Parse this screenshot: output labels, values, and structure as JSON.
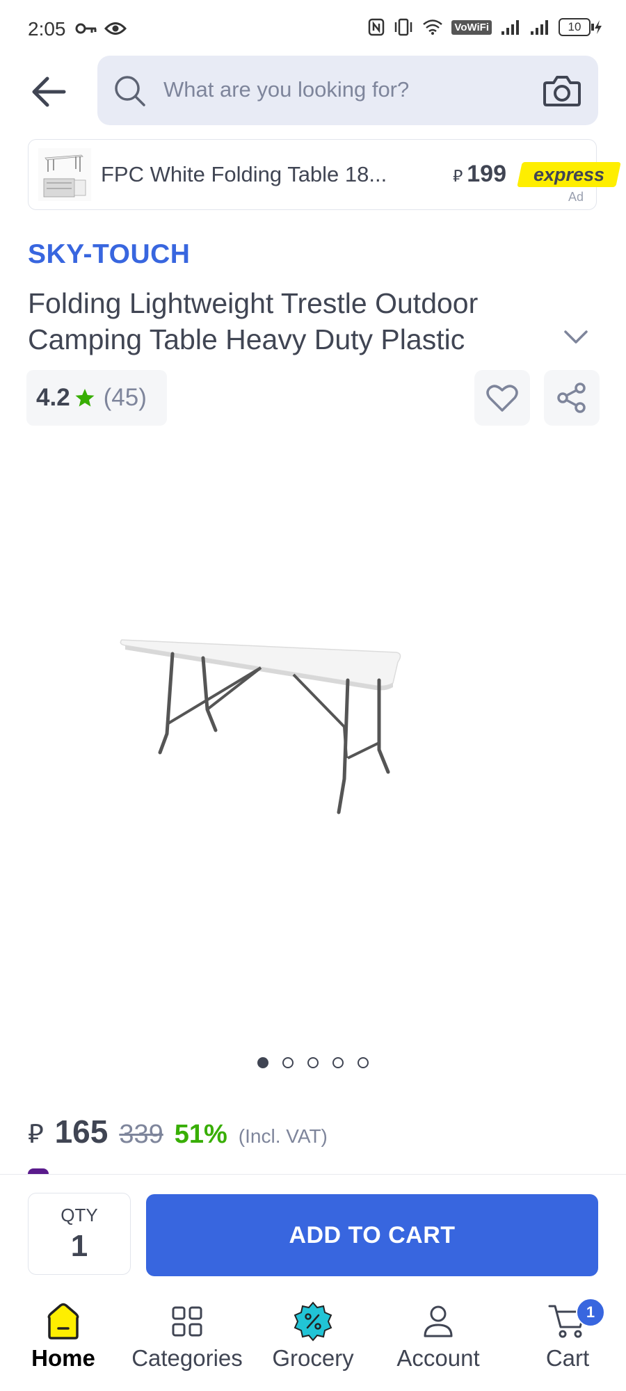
{
  "status_bar": {
    "time": "2:05",
    "vowifi_label": "VoWiFi",
    "battery_level": "10"
  },
  "search": {
    "placeholder": "What are you looking for?"
  },
  "ad": {
    "title": "FPC White Folding Table 18...",
    "currency": "⃁",
    "price": "199",
    "badge": "express",
    "label": "Ad"
  },
  "product": {
    "brand": "SKY-TOUCH",
    "title": "Folding Lightweight Trestle Outdoor Camping Table Heavy Duty Plastic",
    "rating": "4.2",
    "rating_count": "(45)",
    "image_count": 5,
    "active_image": 1,
    "currency": "⃁",
    "price": "165",
    "old_price": "339",
    "discount": "51%",
    "vat_note": "(Incl. VAT)"
  },
  "cart_bar": {
    "qty_label": "QTY",
    "qty_value": "1",
    "add_to_cart": "ADD TO CART"
  },
  "bottom_nav": {
    "items": [
      {
        "label": "Home",
        "icon": "home-icon",
        "active": true
      },
      {
        "label": "Categories",
        "icon": "categories-icon",
        "active": false
      },
      {
        "label": "Grocery",
        "icon": "grocery-icon",
        "active": false
      },
      {
        "label": "Account",
        "icon": "account-icon",
        "active": false
      },
      {
        "label": "Cart",
        "icon": "cart-icon",
        "active": false
      }
    ],
    "cart_count": "1"
  },
  "colors": {
    "brand_blue": "#3866df",
    "express_yellow": "#feee00",
    "discount_green": "#38ae04",
    "text_dark": "#404553",
    "text_muted": "#7e859b"
  }
}
